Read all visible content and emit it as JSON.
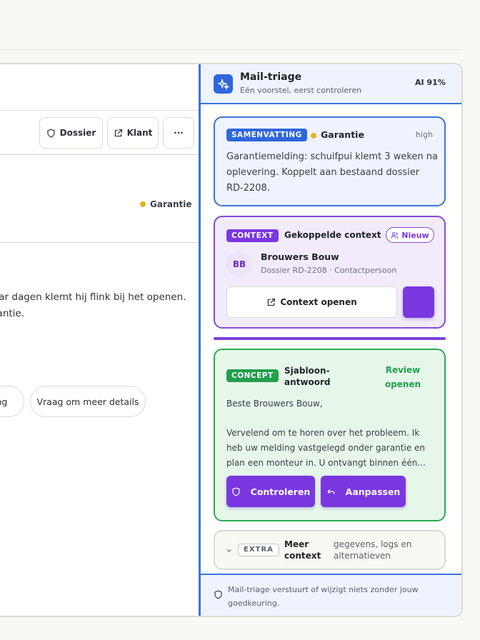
{
  "toolbar": {
    "dossier_label": "Dossier",
    "klant_label": "Klant",
    "more_label": "···"
  },
  "ticket": {
    "tag": "Garantie",
    "message_line1": "aar dagen klemt hij flink bij het openen.",
    "message_line2": "rantie."
  },
  "quick_replies": {
    "chip1": "ing",
    "chip2": "Vraag om meer details"
  },
  "panel": {
    "title": "Mail-triage",
    "subtitle": "Eén voorstel, eerst controleren",
    "score": "AI 91%",
    "summary": {
      "label": "SAMENVATTING",
      "category": "Garantie",
      "priority": "high",
      "text_line1": "Garantiemelding: schuifpui klemt 3 weken na",
      "text_line2": "oplevering. Koppelt aan bestaand dossier",
      "text_line3": "RD-2208."
    },
    "context": {
      "label": "CONTEXT",
      "title": "Gekoppelde context",
      "badge": "Nieuw",
      "avatar": "BB",
      "company": "Brouwers Bouw",
      "meta": "Dossier RD-2208 · Contactpersoon",
      "open_label": "Context openen"
    },
    "concept": {
      "label": "CONCEPT",
      "title_line1": "Sjabloon-",
      "title_line2": "antwoord",
      "review_line1": "Review",
      "review_line2": "openen",
      "greeting": "Beste Brouwers Bouw,",
      "body_line1": "Vervelend om te horen over het probleem. Ik",
      "body_line2": "heb uw melding vastgelegd onder garantie en",
      "body_line3": "plan een monteur in. U ontvangt binnen één...",
      "check_label": "Controleren",
      "edit_label": "Aanpassen"
    },
    "extra": {
      "label": "EXTRA",
      "title_line1": "Meer",
      "title_line2": "context",
      "desc_line1": "gegevens, logs en",
      "desc_line2": "alternatieven"
    },
    "footer": {
      "line1": "Mail-triage verstuurt of wijzigt niets zonder jouw",
      "line2": "goedkeuring."
    }
  },
  "colors": {
    "accent_blue": "#3b74d9",
    "accent_purple": "#7a37e0",
    "accent_green": "#2eaa55",
    "tag_yellow": "#e6b422"
  }
}
